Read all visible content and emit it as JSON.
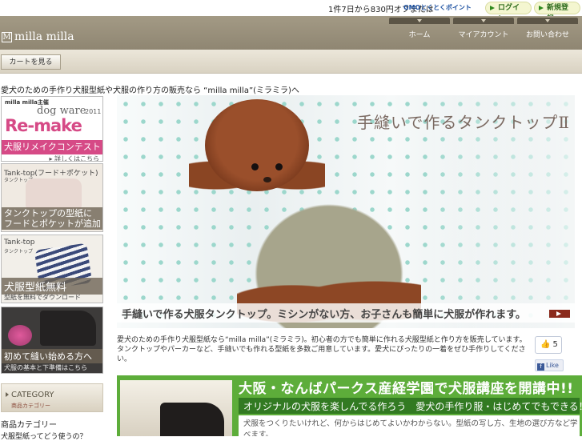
{
  "topbar": {
    "notice": "1件7日から830円オフまたは",
    "gmo_logo": "GMOとくとくポイント",
    "login": "ログイン",
    "register": "新規登録"
  },
  "header": {
    "logo_mark": "M",
    "site_name": "milla milla",
    "nav": [
      "ホーム",
      "マイアカウント",
      "お問い合わせ"
    ]
  },
  "cart_button": "カートを見る",
  "tagline": "愛犬のための手作り犬服型紙や犬服の作り方の販売なら “milla milla”(ミラミラ)へ",
  "sidebar": {
    "banner1": {
      "line1": "milla milla主催",
      "line2": "dog ware",
      "year": "2011",
      "line3": "Re-make",
      "caption": "犬服リメイクコンテスト",
      "link": "▸ 詳しくはこちら"
    },
    "banner2": {
      "title": "Tank-top(フード＋ポケット)",
      "sub": "タンクトップ",
      "caption": "タンクトップの型紙に\nフードとポケットが追加"
    },
    "banner3": {
      "title": "Tank-top",
      "sub": "タンクトップ",
      "caption": "犬服型紙無料",
      "note": "型紙を無料でダウンロード"
    },
    "banner4": {
      "caption": "初めて縫い始める方へ",
      "note": "犬服の基本と下準備はこちら"
    },
    "category": {
      "title": "CATEGORY",
      "sub": "商品カテゴリー",
      "heading": "商品カテゴリー",
      "first_item": "犬服型紙ってどう使うの？"
    }
  },
  "hero": {
    "title": "手縫いで作るタンクトップⅡ",
    "caption": "手縫いで作る犬服タンクトップ。ミシンがない方、お子さんも簡単に犬服が作れます。"
  },
  "intro": "愛犬のための手作り犬服型紙なら“milla milla”(ミラミラ)。初心者の方でも簡単に作れる犬服型紙と作り方を販売しています。タンクトップやパーカーなど、手縫いでも作れる型紙を多数ご用意しています。愛犬にぴったりの一着をぜひ手作りしてください。",
  "social": {
    "like_count": "5",
    "like_label": "Like"
  },
  "lecture": {
    "headline": "大阪・なんばパークス産経学園で犬服講座を開講中!!",
    "sub": "オリジナルの犬服を楽しんでる作ろう　愛犬の手作り服・はじめてでもできる！",
    "body": "犬服をつくりたいけれど、何からはじめてよいかわからない。型紙の写し方、生地の選び方など学べます。"
  },
  "colors": {
    "header_bg": "#9a917c",
    "accent_pink": "#d64a86",
    "lecture_green": "#5dad3a",
    "fb_blue": "#3b5998"
  }
}
